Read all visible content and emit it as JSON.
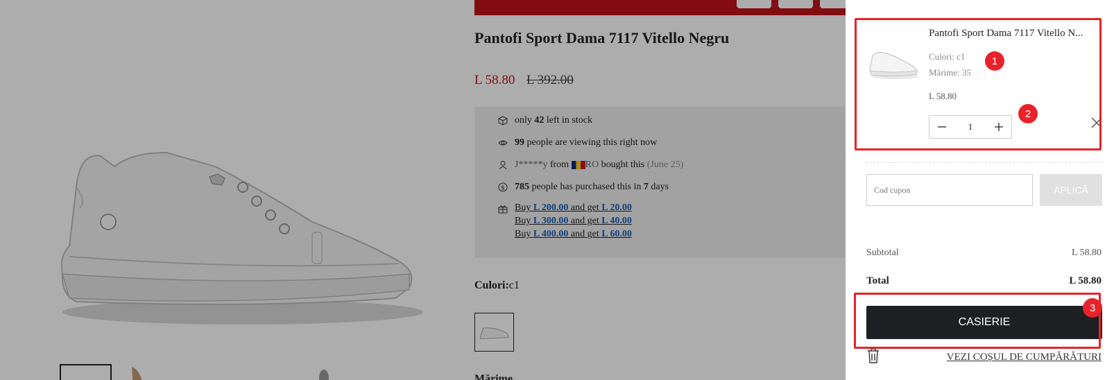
{
  "product": {
    "title": "Pantofi Sport Dama 7117 Vitello Negru",
    "price": "L 58.80",
    "old_price": "L 392.00",
    "colors_label": "Culori:",
    "colors_value": "c1",
    "size_label": "Mărime"
  },
  "info": {
    "stock_pre": "only ",
    "stock_count": "42",
    "stock_post": " left in stock",
    "viewing_count": "99",
    "viewing_post": " people are viewing this right now",
    "buyer_name": "J*****y",
    "buyer_from": " from ",
    "buyer_country": "RO",
    "buyer_post": " bought this ",
    "buyer_date": "(June 25)",
    "purchased_count": "785",
    "purchased_mid": " people has purchased this in ",
    "purchased_days": "7",
    "purchased_post": " days",
    "promos": [
      {
        "buy": "Buy ",
        "amount": "L 200.00",
        "mid": " and get ",
        "reward": "L 20.00"
      },
      {
        "buy": "Buy ",
        "amount": "L 300.00",
        "mid": " and get ",
        "reward": "L 40.00"
      },
      {
        "buy": "Buy ",
        "amount": "L 400.00",
        "mid": " and get ",
        "reward": "L 60.00"
      }
    ]
  },
  "cart": {
    "item_name": "Pantofi Sport Dama 7117 Vitello N...",
    "color_line": "Culori: c1",
    "size_line": "Mărime: 35",
    "item_price": "L 58.80",
    "quantity": "1",
    "coupon_placeholder": "Cod cupon",
    "apply_label": "APLICĂ",
    "subtotal_label": "Subtotal",
    "subtotal_value": "L 58.80",
    "total_label": "Total",
    "total_value": "L 58.80",
    "checkout_label": "CASIERIE",
    "view_cart_label": "VEZI COȘUL DE CUMPĂRĂTURI"
  },
  "annotations": [
    "1",
    "2",
    "3"
  ],
  "colors": {
    "accent_red": "#c0141a",
    "annotation_red": "#e8222a",
    "checkout_dark": "#1e1f22",
    "link_blue": "#1a5fb4"
  }
}
